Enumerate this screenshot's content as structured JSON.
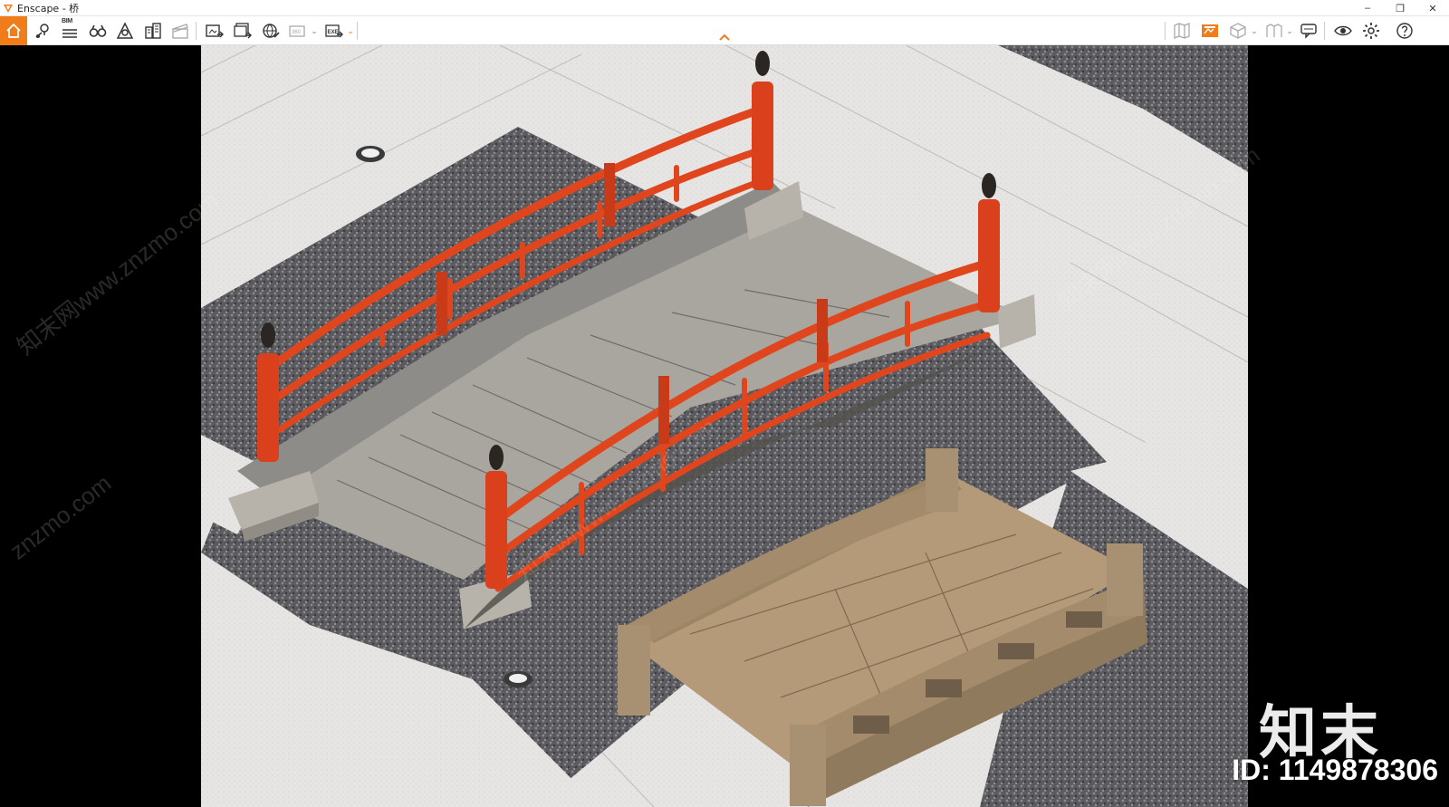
{
  "window": {
    "title": "Enscape - 桥",
    "controls": {
      "minimize": "–",
      "restore": "❐",
      "close": "✕"
    }
  },
  "toolbar": {
    "bim_label": "BIM",
    "caret": "⌄",
    "accent": "#f07d1a"
  },
  "watermark": {
    "logo_text": "知末",
    "id_text": "ID: 1149878306",
    "diagonal_text_1": "知末网www.znzmo.com",
    "diagonal_text_2": "znzmo.com"
  },
  "colors": {
    "railing": "#e0461e",
    "stone_bridge": "#b49a78",
    "gravel": "#5a585c",
    "paving": "#e6e4e2"
  }
}
